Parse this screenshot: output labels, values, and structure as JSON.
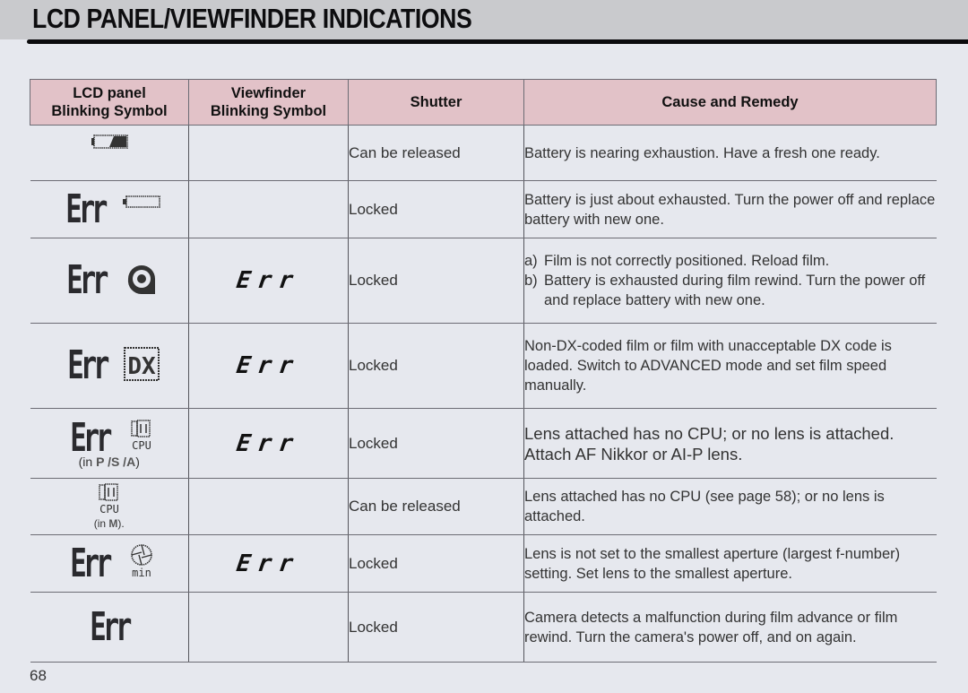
{
  "page": {
    "title": "LCD PANEL/VIEWFINDER INDICATIONS",
    "page_number": "68"
  },
  "table": {
    "headers": {
      "lcd_line1": "LCD panel",
      "lcd_line2": "Blinking Symbol",
      "vf_line1": "Viewfinder",
      "vf_line2": "Blinking Symbol",
      "shutter": "Shutter",
      "cause": "Cause and Remedy"
    },
    "header_color": "#e2c2c8",
    "rows": [
      {
        "lcd_text": "",
        "lcd_icon": "battery-low-icon",
        "vf_text": "",
        "shutter": "Can be released",
        "cause": "Battery is nearing exhaustion. Have a fresh one ready."
      },
      {
        "lcd_text": "Err",
        "lcd_icon": "battery-empty-icon",
        "vf_text": "",
        "shutter": "Locked",
        "cause": "Battery is just about exhausted. Turn the power off and replace battery with new one."
      },
      {
        "lcd_text": "Err",
        "lcd_icon": "film-cartridge-icon",
        "vf_text": "Err",
        "shutter": "Locked",
        "cause_a_key": "a)",
        "cause_a": "Film is not correctly positioned. Reload film.",
        "cause_b_key": "b)",
        "cause_b": "Battery is exhausted during film rewind. Turn the power off and replace battery with new one."
      },
      {
        "lcd_text": "Err",
        "lcd_icon": "dx-icon",
        "lcd_icon_label": "DX",
        "vf_text": "Err",
        "shutter": "Locked",
        "cause": "Non-DX-coded film or film with unacceptable DX code is loaded. Switch to ADVANCED mode and set film speed manually."
      },
      {
        "lcd_text": "Err",
        "lcd_icon": "cpu-lens-icon",
        "lcd_icon_label": "CPU",
        "lcd_note_prefix": "(in ",
        "lcd_note_modes": "P /S /A",
        "lcd_note_suffix": ")",
        "vf_text": "Err",
        "shutter": "Locked",
        "cause": "Lens attached has no CPU; or no lens is attached. Attach AF Nikkor or AI-P lens."
      },
      {
        "lcd_text": "",
        "lcd_icon": "cpu-lens-icon",
        "lcd_icon_label": "CPU",
        "lcd_note_prefix": "(in ",
        "lcd_note_modes": "M",
        "lcd_note_suffix": ").",
        "vf_text": "",
        "shutter": "Can be released",
        "cause": "Lens attached has no CPU (see page 58); or no lens is attached."
      },
      {
        "lcd_text": "Err",
        "lcd_icon": "aperture-min-icon",
        "lcd_icon_label": "min",
        "vf_text": "Err",
        "shutter": "Locked",
        "cause": "Lens is not set to the smallest aperture (largest f-number) setting. Set lens to the smallest aperture."
      },
      {
        "lcd_text": "Err",
        "lcd_icon": "",
        "vf_text": "",
        "shutter": "Locked",
        "cause": "Camera detects a malfunction during film advance or film rewind. Turn the camera's power off, and on again."
      }
    ]
  }
}
